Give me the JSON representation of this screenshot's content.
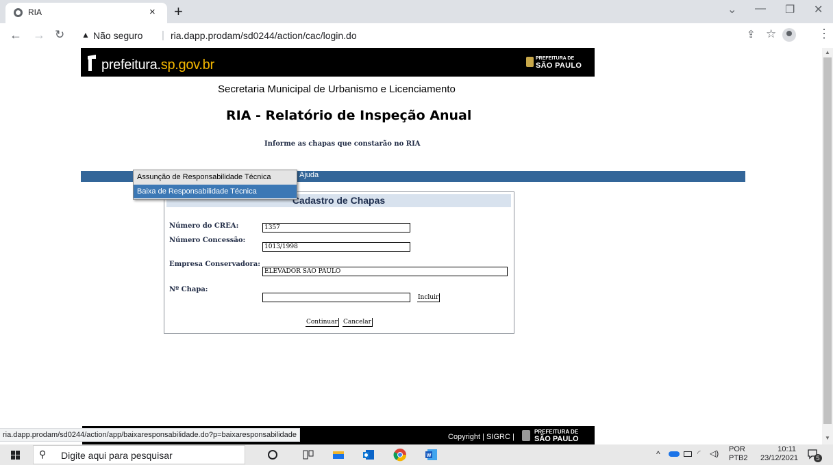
{
  "browser": {
    "tab_title": "RIA",
    "tab_close": "×",
    "new_tab": "+",
    "security_label": "Não seguro",
    "separator": "|",
    "url": "ria.dapp.prodam/sd0244/action/cac/login.do",
    "controls": {
      "minimize": "—",
      "restore": "❐",
      "close": "✕",
      "tab_search": "⌄"
    }
  },
  "page": {
    "logo_text_main": "prefeitura.",
    "logo_text_domain": "sp.gov.br",
    "brand_line1": "PREFEITURA DE",
    "brand_line2": "SÃO PAULO",
    "secretaria": "Secretaria Municipal de Urbanismo e Licenciamento",
    "heading": "RIA - Relatório de Inspeção Anual",
    "instructions": "Informe as chapas que constarão no RIA"
  },
  "menu": {
    "ajuda": "Ajuda",
    "dropdown_items": [
      "Assunção de Responsabilidade Técnica",
      "Baixa de Responsabilidade Técnica"
    ],
    "highlighted_index": 1
  },
  "form": {
    "title": "Cadastro de Chapas",
    "crea_label": "Número do CREA:",
    "crea_value": "1357",
    "concessao_label": "Número Concessão:",
    "concessao_value": "1013/1998",
    "empresa_label": "Empresa Conservadora:",
    "empresa_value": "ELEVADOR SAO PAULO",
    "chapa_label": "Nº Chapa:",
    "chapa_value": "",
    "incluir": "Incluir",
    "continuar": "Continuar",
    "cancelar": "Cancelar"
  },
  "footer": {
    "copyright": "Copyright | SIGRC |",
    "brand_line1": "PREFEITURA DE",
    "brand_line2": "SÃO PAULO",
    "status_url": "ria.dapp.prodam/sd0244/action/app/baixaresponsabilidade.do?p=baixaresponsabilidade"
  },
  "taskbar": {
    "search_placeholder": "Digite aqui para pesquisar",
    "lang_top": "POR",
    "lang_bottom": "PTB2",
    "time": "10:11",
    "date": "23/12/2021",
    "notification_count": "5"
  },
  "colors": {
    "menubar": "#336699",
    "highlight": "#3c78b5",
    "panel_header": "#d8e2ee",
    "domain_accent": "#f5b800"
  }
}
